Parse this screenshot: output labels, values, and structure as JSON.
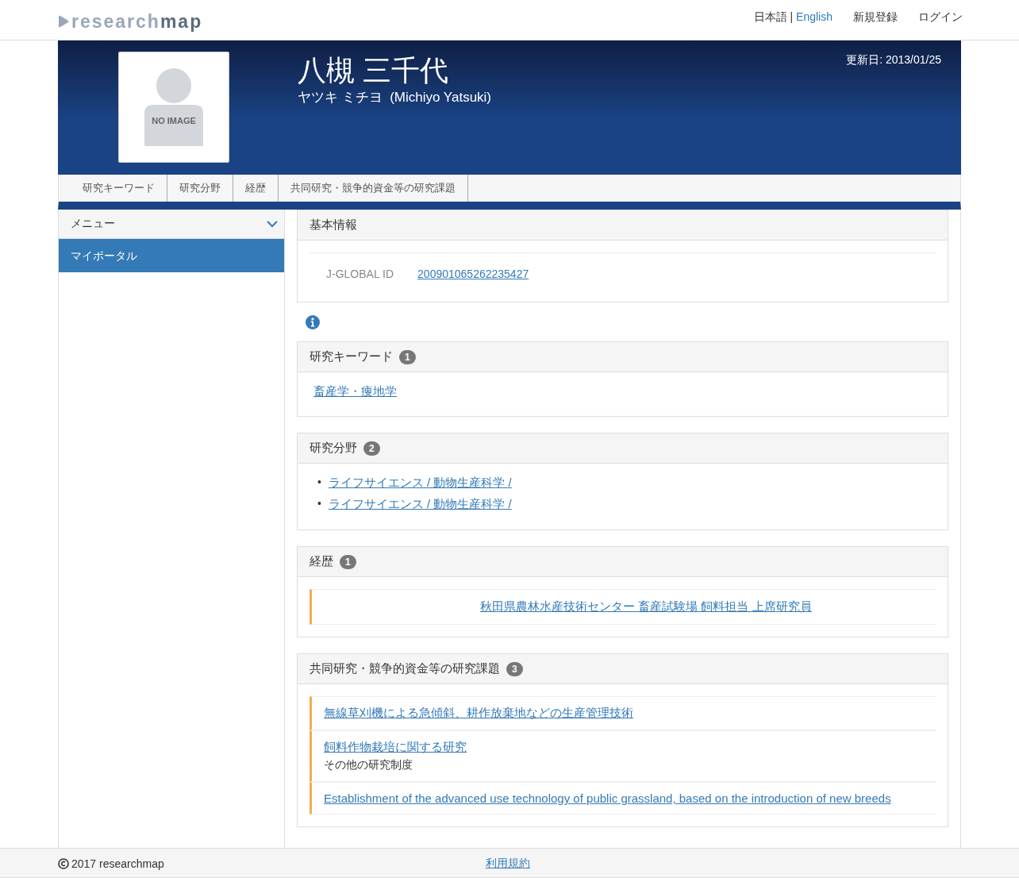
{
  "logo": {
    "light": "research",
    "bold": "map"
  },
  "header_nav": {
    "language_current": "日本語",
    "separator": "|",
    "language_other": "English",
    "links": [
      "新規登録",
      "ログイン"
    ]
  },
  "profile": {
    "photo_label": "NO IMAGE",
    "name": "八槻 三千代",
    "reading": "ヤツキ ミチヨ  (Michiyo Yatsuki)",
    "updated": "更新日: 2013/01/25"
  },
  "tabs": [
    {
      "label": "研究キーワード"
    },
    {
      "label": "研究分野"
    },
    {
      "label": "経歴"
    },
    {
      "label": "共同研究・競争的資金等の研究課題"
    }
  ],
  "sidebar": {
    "title": "メニュー",
    "expanded": true,
    "items": [
      {
        "label": "マイポータル",
        "selected": true
      }
    ]
  },
  "sections": [
    {
      "kind": "fields",
      "title": "基本情報",
      "fields": [
        {
          "label": "J-GLOBAL ID",
          "value": "200901065262235427"
        }
      ]
    },
    {
      "kind": "info"
    },
    {
      "kind": "plain",
      "title": "研究キーワード",
      "count": "1",
      "items": [
        {
          "link": "畜産学・痩地学"
        }
      ]
    },
    {
      "kind": "bullets",
      "title": "研究分野",
      "count": "2",
      "items": [
        {
          "marker": "•",
          "link": "ライフサイエンス / 動物生産科学 /"
        },
        {
          "marker": "•",
          "link": "ライフサイエンス / 動物生産科学 /"
        }
      ]
    },
    {
      "kind": "centered",
      "title": "経歴",
      "count": "1",
      "items": [
        {
          "link": "秋田県農林水産技術センター 畜産試験場 飼料担当 上席研究員"
        }
      ]
    },
    {
      "kind": "accent",
      "title": "共同研究・競争的資金等の研究課題",
      "count": "3",
      "items": [
        {
          "link": "無線草刈機による急傾斜、耕作放棄地などの生産管理技術"
        },
        {
          "link": "飼料作物栽培に関する研究",
          "note": "その他の研究制度"
        },
        {
          "link": "Establishment of the advanced use technology of public grassland, based on the introduction of new breeds"
        }
      ]
    }
  ],
  "footer": {
    "copyright": "2017 researchmap",
    "link": "利用規約"
  }
}
